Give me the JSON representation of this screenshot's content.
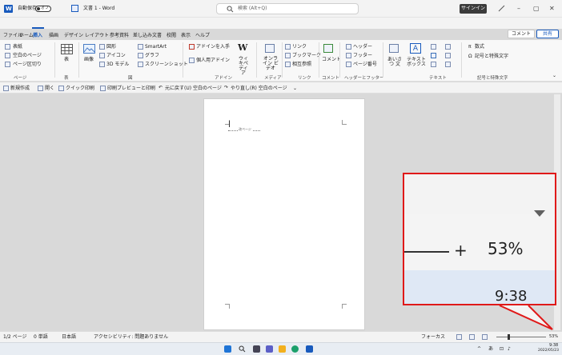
{
  "titlebar": {
    "autosave_label": "自動保存",
    "autosave_state": "オフ",
    "doc_title": "文書 1 - Word",
    "search_placeholder": "検索 (Alt+Q)",
    "signin_label": "サインイン",
    "minimize_glyph": "–",
    "restore_glyph": "▢",
    "close_glyph": "✕"
  },
  "tabs": [
    {
      "label": "ファイル"
    },
    {
      "label": "ホーム"
    },
    {
      "label": "挿入"
    },
    {
      "label": "描画"
    },
    {
      "label": "デザイン"
    },
    {
      "label": "レイアウト"
    },
    {
      "label": "参考資料"
    },
    {
      "label": "差し込み文書"
    },
    {
      "label": "校閲"
    },
    {
      "label": "表示"
    },
    {
      "label": "ヘルプ"
    }
  ],
  "comment_label": "コメント",
  "share_label": "共有",
  "ribbon": {
    "pages": {
      "items": [
        "表紙",
        "空白のページ",
        "ページ区切り"
      ],
      "label": "ページ"
    },
    "table": {
      "button": "表",
      "label": "表"
    },
    "illustrations": {
      "image": "画像",
      "items": [
        "図形",
        "アイコン",
        "3D モデル",
        "SmartArt",
        "グラフ",
        "スクリーンショット"
      ],
      "label": "図"
    },
    "addins": {
      "get": "アドインを入手",
      "mine": "個人用アドイン",
      "wiki": "ウィキペディア",
      "label": "アドイン"
    },
    "media": {
      "video": "オンライン ビデオ",
      "label": "メディア"
    },
    "links": {
      "items": [
        "リンク",
        "ブックマーク",
        "相互参照"
      ],
      "label": "リンク"
    },
    "comments": {
      "button": "コメント",
      "label": "コメント"
    },
    "header_footer": {
      "items": [
        "ヘッダー",
        "フッター",
        "ページ番号"
      ],
      "label": "ヘッダーとフッター"
    },
    "text": {
      "textbox": "テキスト ボックス",
      "items": [
        "あいさつ 文",
        "テキスト ボックス",
        "A"
      ],
      "label": "テキスト"
    },
    "symbols": {
      "equation": "数式",
      "symbol": "記号と特殊文字",
      "label": "記号と特殊文字"
    }
  },
  "qat": {
    "items": [
      "新規作成",
      "開く",
      "クイック印刷",
      "印刷プレビューと印刷",
      "元に戻す(U) 空白のページ",
      "やり直し(R) 空白のページ"
    ]
  },
  "document": {
    "page_break_label": "改ページ"
  },
  "statusbar": {
    "page": "1/2 ページ",
    "words": "0 単語",
    "language": "日本語",
    "accessibility": "アクセシビリティ: 問題ありません",
    "focus": "フォーカス",
    "zoom": "53%",
    "zoom_level": 0.53
  },
  "callout": {
    "zoom_plus": "+",
    "zoom_text": "53%",
    "time_text": "9:38",
    "colors": {
      "border": "#e01919",
      "time_bg": "#dfe8f5"
    }
  },
  "taskbar": {
    "time": "9:38",
    "date": "2022/05/23",
    "ime": "あ",
    "tray_up": "^"
  },
  "colors": {
    "word_blue": "#185abd",
    "accent_red": "#e01919"
  }
}
